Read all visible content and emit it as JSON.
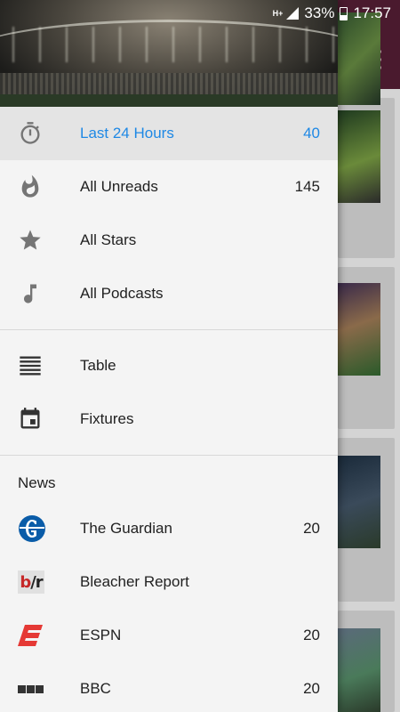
{
  "status_bar": {
    "network": "H+",
    "battery": "33%",
    "time": "17:57"
  },
  "drawer": {
    "primary_items": [
      {
        "label": "Last 24 Hours",
        "count": "40",
        "icon": "timer-icon",
        "active": true
      },
      {
        "label": "All Unreads",
        "count": "145",
        "icon": "flame-icon",
        "active": false
      },
      {
        "label": "All Stars",
        "count": "",
        "icon": "star-icon",
        "active": false
      },
      {
        "label": "All Podcasts",
        "count": "",
        "icon": "music-note-icon",
        "active": false
      }
    ],
    "secondary_items": [
      {
        "label": "Table",
        "icon": "table-icon"
      },
      {
        "label": "Fixtures",
        "icon": "calendar-icon"
      }
    ],
    "news_section_title": "News",
    "news_items": [
      {
        "label": "The Guardian",
        "count": "20",
        "icon": "guardian-logo-icon"
      },
      {
        "label": "Bleacher Report",
        "count": "",
        "icon": "bleacher-report-logo-icon"
      },
      {
        "label": "ESPN",
        "count": "20",
        "icon": "espn-logo-icon"
      },
      {
        "label": "BBC",
        "count": "20",
        "icon": "bbc-logo-icon"
      }
    ]
  },
  "colors": {
    "accent": "#1e88e5",
    "toolbar": "#4a1a2e",
    "active_bg": "#e4e4e4"
  }
}
